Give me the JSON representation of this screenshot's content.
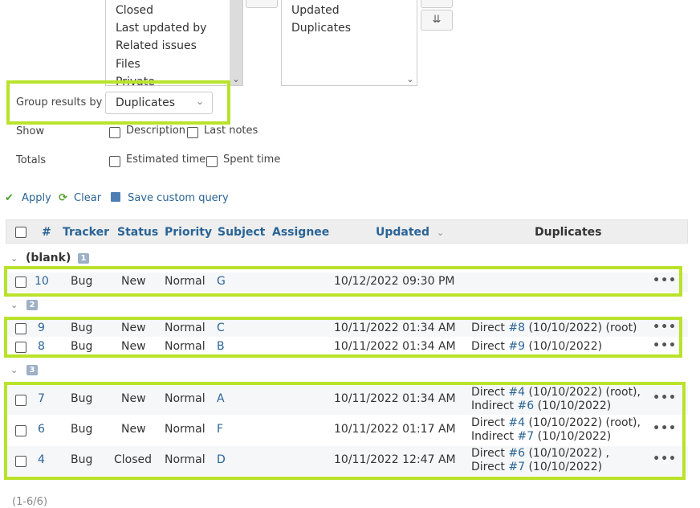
{
  "available_columns": [
    "Closed",
    "Last updated by",
    "Related issues",
    "Files",
    "Private"
  ],
  "selected_columns": [
    "Updated",
    "Duplicates"
  ],
  "order_buttons": {
    "move_down": "⇣",
    "move_bottom": "⇊"
  },
  "group": {
    "label": "Group results by",
    "value": "Duplicates"
  },
  "show": {
    "label": "Show",
    "options": [
      "Description",
      "Last notes"
    ]
  },
  "totals": {
    "label": "Totals",
    "options": [
      "Estimated time",
      "Spent time"
    ]
  },
  "actions": {
    "apply": "Apply",
    "clear": "Clear",
    "save": "Save custom query"
  },
  "table": {
    "columns": [
      "#",
      "Tracker",
      "Status",
      "Priority",
      "Subject",
      "Assignee",
      "Updated",
      "Duplicates"
    ],
    "groups": [
      {
        "name": "(blank)",
        "count": "1",
        "rows": [
          {
            "id": "10",
            "tracker": "Bug",
            "status": "New",
            "priority": "Normal",
            "subject": "G",
            "updated": "10/12/2022 09:30 PM"
          }
        ]
      },
      {
        "name": "",
        "count": "2",
        "rows": [
          {
            "id": "9",
            "tracker": "Bug",
            "status": "New",
            "priority": "Normal",
            "subject": "C",
            "updated": "10/11/2022 01:34 AM",
            "dup1_pre": "Direct ",
            "dup1_link": "#8",
            "dup1_post": " (10/10/2022) (root)"
          },
          {
            "id": "8",
            "tracker": "Bug",
            "status": "New",
            "priority": "Normal",
            "subject": "B",
            "updated": "10/11/2022 01:34 AM",
            "dup1_pre": "Direct ",
            "dup1_link": "#9",
            "dup1_post": " (10/10/2022)"
          }
        ]
      },
      {
        "name": "",
        "count": "3",
        "rows": [
          {
            "id": "7",
            "tracker": "Bug",
            "status": "New",
            "priority": "Normal",
            "subject": "A",
            "updated": "10/11/2022 01:34 AM",
            "dup1_pre": "Direct ",
            "dup1_link": "#4",
            "dup1_post": " (10/10/2022) (root),",
            "dup2_pre": "Indirect ",
            "dup2_link": "#6",
            "dup2_post": " (10/10/2022)"
          },
          {
            "id": "6",
            "tracker": "Bug",
            "status": "New",
            "priority": "Normal",
            "subject": "F",
            "updated": "10/11/2022 01:17 AM",
            "dup1_pre": "Direct ",
            "dup1_link": "#4",
            "dup1_post": " (10/10/2022) (root),",
            "dup2_pre": "Indirect ",
            "dup2_link": "#7",
            "dup2_post": " (10/10/2022)"
          },
          {
            "id": "4",
            "tracker": "Bug",
            "status": "Closed",
            "priority": "Normal",
            "subject": "D",
            "updated": "10/11/2022 12:47 AM",
            "dup1_pre": "Direct ",
            "dup1_link": "#6",
            "dup1_post": " (10/10/2022) ,",
            "dup2_pre": "Direct ",
            "dup2_link": "#7",
            "dup2_post": " (10/10/2022)"
          }
        ]
      }
    ]
  },
  "more_icon": "•••",
  "footer": "(1-6/6)",
  "colors": {
    "highlight": "#b9e32b",
    "link": "#2a6496",
    "header_bg": "#eeeeee"
  }
}
